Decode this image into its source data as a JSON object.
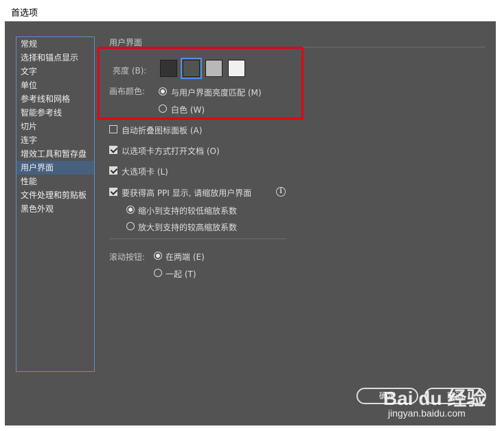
{
  "window": {
    "title": "首选项"
  },
  "sidebar": {
    "items": [
      {
        "label": "常规"
      },
      {
        "label": "选择和锚点显示"
      },
      {
        "label": "文字"
      },
      {
        "label": "单位"
      },
      {
        "label": "参考线和网格"
      },
      {
        "label": "智能参考线"
      },
      {
        "label": "切片"
      },
      {
        "label": "连字"
      },
      {
        "label": "增效工具和暂存盘"
      },
      {
        "label": "用户界面",
        "selected": true
      },
      {
        "label": "性能"
      },
      {
        "label": "文件处理和剪贴板"
      },
      {
        "label": "黑色外观"
      }
    ]
  },
  "section": {
    "title": "用户界面"
  },
  "brightness": {
    "label": "亮度 (B):",
    "swatches": [
      "#333333",
      "#535353",
      "#b8b8b8",
      "#f0f0f0"
    ],
    "selected_index": 1
  },
  "canvas_color": {
    "label": "画布颜色:",
    "option_match": "与用户界面亮度匹配 (M)",
    "option_white": "白色 (W)",
    "selected": "match"
  },
  "options": {
    "auto_collapse": {
      "label": "自动折叠图标面板 (A)",
      "checked": false
    },
    "open_tabs": {
      "label": "以选项卡方式打开文档 (O)",
      "checked": true
    },
    "large_tabs": {
      "label": "大选项卡 (L)",
      "checked": true
    },
    "high_ppi": {
      "label": "要获得高 PPI 显示, 请缩放用户界面",
      "checked": true
    },
    "scale_down": {
      "label": "缩小到支持的较低缩放系数",
      "selected": true
    },
    "scale_up": {
      "label": "放大到支持的较高缩放系数",
      "selected": false
    }
  },
  "scroll_buttons": {
    "label": "滚动按钮:",
    "option_ends": "在两端 (E)",
    "option_together": "一起 (T)",
    "selected": "ends"
  },
  "buttons": {
    "ok": "确定",
    "cancel": "取消"
  },
  "watermark": {
    "brand": "Bai du 经验",
    "url": "jingyan.baidu.com"
  }
}
